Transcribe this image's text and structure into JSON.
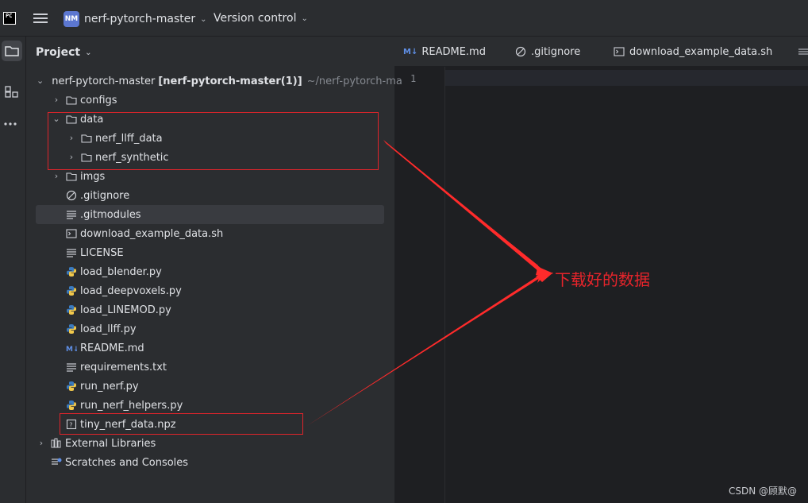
{
  "titlebar": {
    "app_logo": "PC",
    "project_badge": "NM",
    "project_name": "nerf-pytorch-master",
    "vcs_label": "Version control"
  },
  "project_panel": {
    "header": "Project",
    "root": {
      "name": "nerf-pytorch-master",
      "module": "[nerf-pytorch-master(1)]",
      "path": "~/nerf-pytorch-ma"
    },
    "items": [
      {
        "name": "configs",
        "kind": "folder"
      },
      {
        "name": "data",
        "kind": "folder"
      },
      {
        "name": "nerf_llff_data",
        "kind": "folder"
      },
      {
        "name": "nerf_synthetic",
        "kind": "folder"
      },
      {
        "name": "imgs",
        "kind": "folder"
      },
      {
        "name": ".gitignore",
        "kind": "gitignore"
      },
      {
        "name": ".gitmodules",
        "kind": "text"
      },
      {
        "name": "download_example_data.sh",
        "kind": "shell"
      },
      {
        "name": "LICENSE",
        "kind": "text"
      },
      {
        "name": "load_blender.py",
        "kind": "python"
      },
      {
        "name": "load_deepvoxels.py",
        "kind": "python"
      },
      {
        "name": "load_LINEMOD.py",
        "kind": "python"
      },
      {
        "name": "load_llff.py",
        "kind": "python"
      },
      {
        "name": "README.md",
        "kind": "markdown"
      },
      {
        "name": "requirements.txt",
        "kind": "text"
      },
      {
        "name": "run_nerf.py",
        "kind": "python"
      },
      {
        "name": "run_nerf_helpers.py",
        "kind": "python"
      },
      {
        "name": "tiny_nerf_data.npz",
        "kind": "unknown"
      }
    ],
    "external_libraries": "External Libraries",
    "scratches": "Scratches and Consoles"
  },
  "editor": {
    "tabs": [
      {
        "label": "README.md",
        "icon": "markdown-icon"
      },
      {
        "label": ".gitignore",
        "icon": "gitignore-icon"
      },
      {
        "label": "download_example_data.sh",
        "icon": "shell-script-icon"
      }
    ],
    "line_number": "1"
  },
  "annotation": {
    "text": "下载好的数据",
    "color": "#e8242b"
  },
  "watermark": "CSDN @顾默@",
  "colors": {
    "background": "#2b2d30",
    "editor_bg": "#1e1f22",
    "selection": "#393b40",
    "accent_badge": "#5c77d1",
    "annotation_red": "#e0242b"
  }
}
